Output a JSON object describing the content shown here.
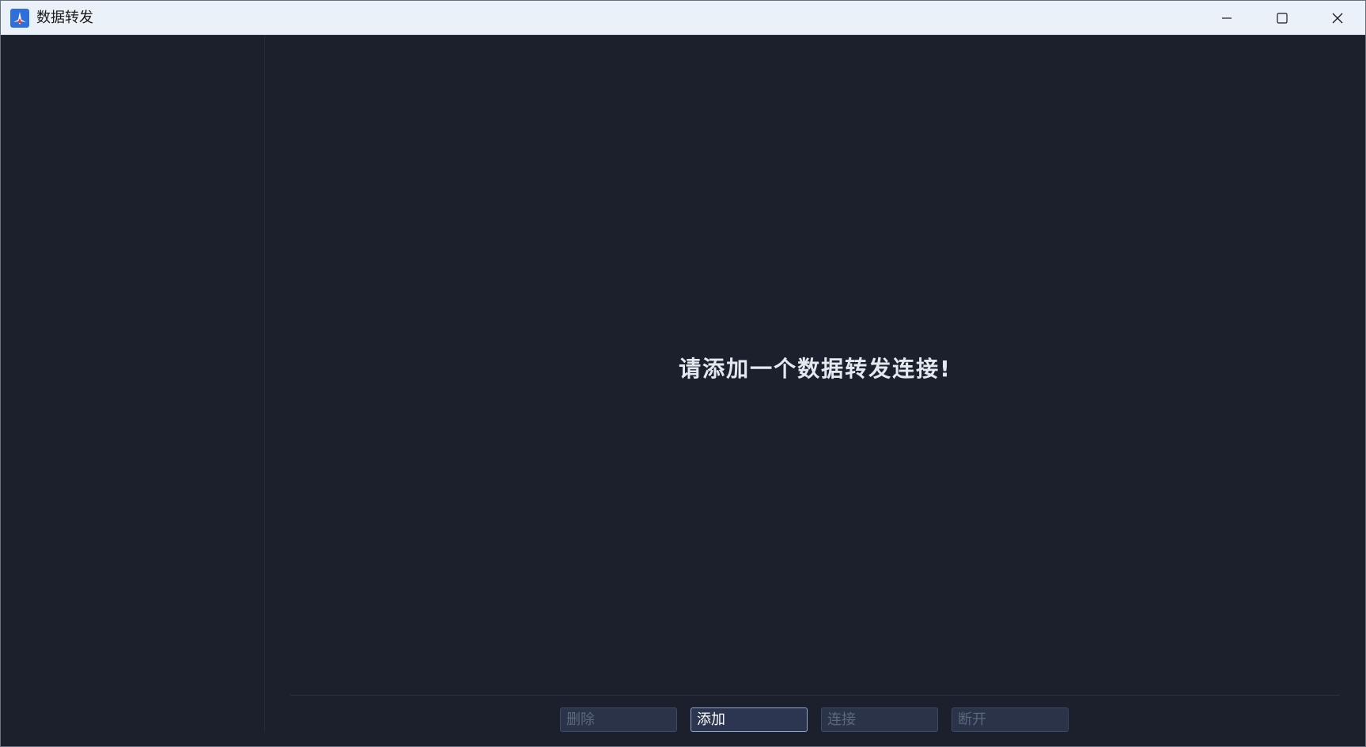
{
  "window": {
    "title": "数据转发",
    "icon": "app-logo-icon",
    "controls": [
      "minimize-icon",
      "maximize-icon",
      "close-icon"
    ]
  },
  "main": {
    "empty_message": "请添加一个数据转发连接!"
  },
  "actions": {
    "delete_label": "删除",
    "add_label": "添加",
    "connect_label": "连接",
    "disconnect_label": "断开"
  },
  "colors": {
    "background": "#1b202c",
    "titlebar": "#ebf1f8",
    "button_bg": "#2a3347",
    "button_disabled_text": "#5c6780",
    "button_active_text": "#ffffff"
  }
}
